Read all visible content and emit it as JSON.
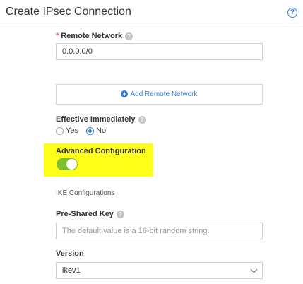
{
  "header": {
    "title": "Create IPsec Connection",
    "help_glyph": "?"
  },
  "remote_network": {
    "label": "Remote Network",
    "required_mark": "*",
    "value": "0.0.0.0/0"
  },
  "add_remote": {
    "label": "Add Remote Network",
    "icon_glyph": "+"
  },
  "effective": {
    "label": "Effective Immediately",
    "options": [
      "Yes",
      "No"
    ],
    "selected": "No"
  },
  "advanced": {
    "label": "Advanced Configuration",
    "enabled": true
  },
  "ike": {
    "section_label": "IKE Configurations"
  },
  "psk": {
    "label": "Pre-Shared Key",
    "placeholder": "The default value is a 16-bit random string."
  },
  "version": {
    "label": "Version",
    "value": "ikev1"
  },
  "icons": {
    "help": "question-circle-icon",
    "info": "question-mark-icon",
    "add": "plus-circle-icon",
    "dropdown": "chevron-down-icon"
  },
  "colors": {
    "accent": "#3a7bd5",
    "toggle_on": "#7cbf2f",
    "required": "#e34d4d",
    "highlight": "#ffff1a"
  }
}
